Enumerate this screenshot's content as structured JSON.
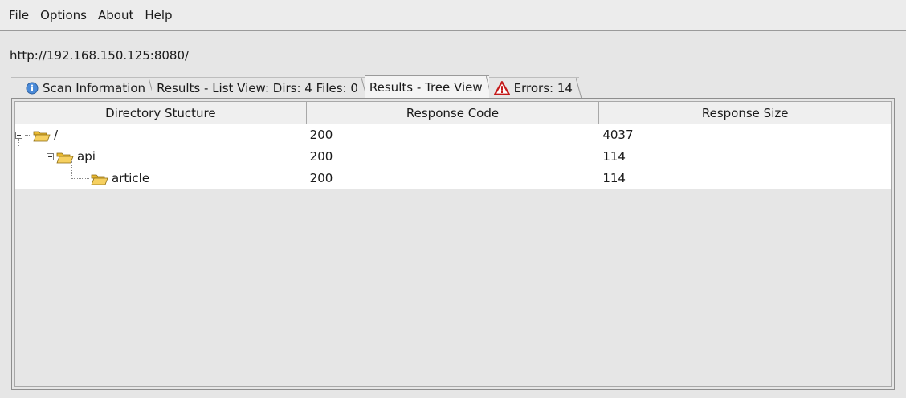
{
  "menu": {
    "items": [
      "File",
      "Options",
      "About",
      "Help"
    ]
  },
  "url": "http://192.168.150.125:8080/",
  "tabs": [
    {
      "label": "Scan Information",
      "icon": "info-icon"
    },
    {
      "label": "Results - List View: Dirs: 4 Files: 0",
      "icon": ""
    },
    {
      "label": "Results - Tree View",
      "icon": "",
      "active": true
    },
    {
      "label": "Errors: 14",
      "icon": "warning-icon"
    }
  ],
  "table": {
    "headers": [
      "Directory Stucture",
      "Response Code",
      "Response Size"
    ],
    "rows": [
      {
        "name": "/",
        "code": "200",
        "size": "4037"
      },
      {
        "name": "api",
        "code": "200",
        "size": "114"
      },
      {
        "name": "article",
        "code": "200",
        "size": "114"
      }
    ]
  },
  "colors": {
    "folder": "#f2c744",
    "warning": "#d11f1f",
    "info": "#3b7fd0"
  }
}
